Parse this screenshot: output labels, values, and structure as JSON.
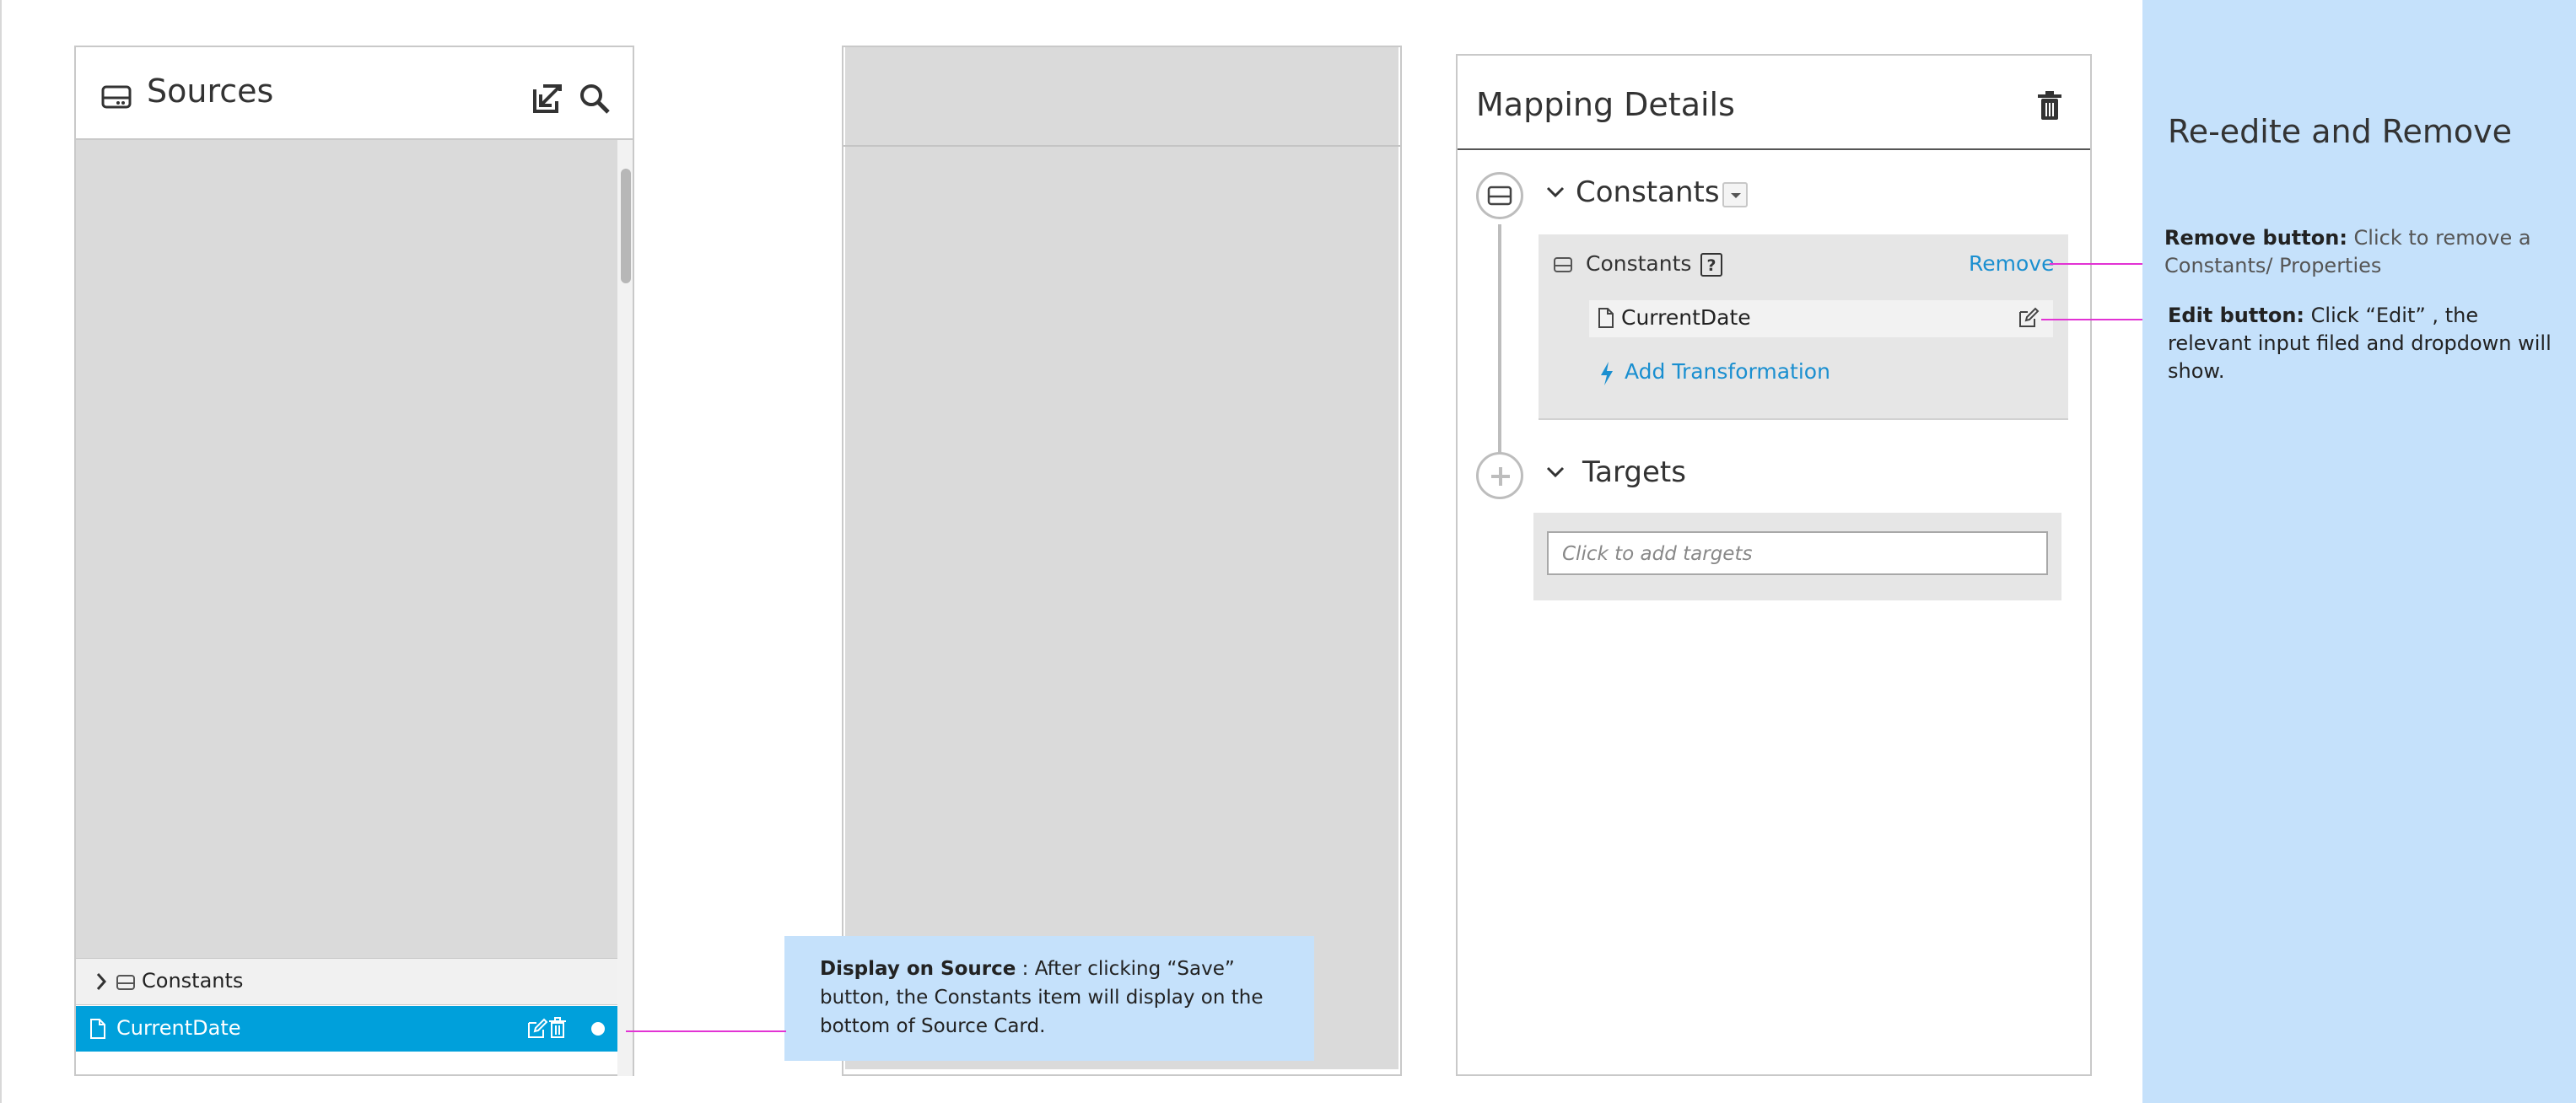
{
  "sources": {
    "title": "Sources",
    "rows": [
      {
        "label": "Constants"
      },
      {
        "label": "CurrentDate"
      }
    ]
  },
  "callout": {
    "heading": "Display on Source",
    "text": " : After clicking “Save” button,  the Constants item will display on the bottom of Source Card."
  },
  "mapping": {
    "title": "Mapping Details",
    "constants_section": "Constants",
    "constants_box_title": "Constants",
    "help_label": "?",
    "remove_label": "Remove",
    "field_label": "CurrentDate",
    "add_transformation": "Add Transformation",
    "targets_section": "Targets",
    "targets_placeholder": "Click to add targets"
  },
  "annotations": {
    "title": "Re-edite and Remove",
    "remove_heading": "Remove button:",
    "remove_text": " Click to remove a Constants/ Properties",
    "edit_heading": "Edit button:",
    "edit_text": " Click “Edit” , the relevant input filed and dropdown will show."
  },
  "colors": {
    "accent": "#00a0db",
    "link": "#1a8fd0",
    "note_bg": "#c5e1fb",
    "connector": "#e233d4"
  }
}
